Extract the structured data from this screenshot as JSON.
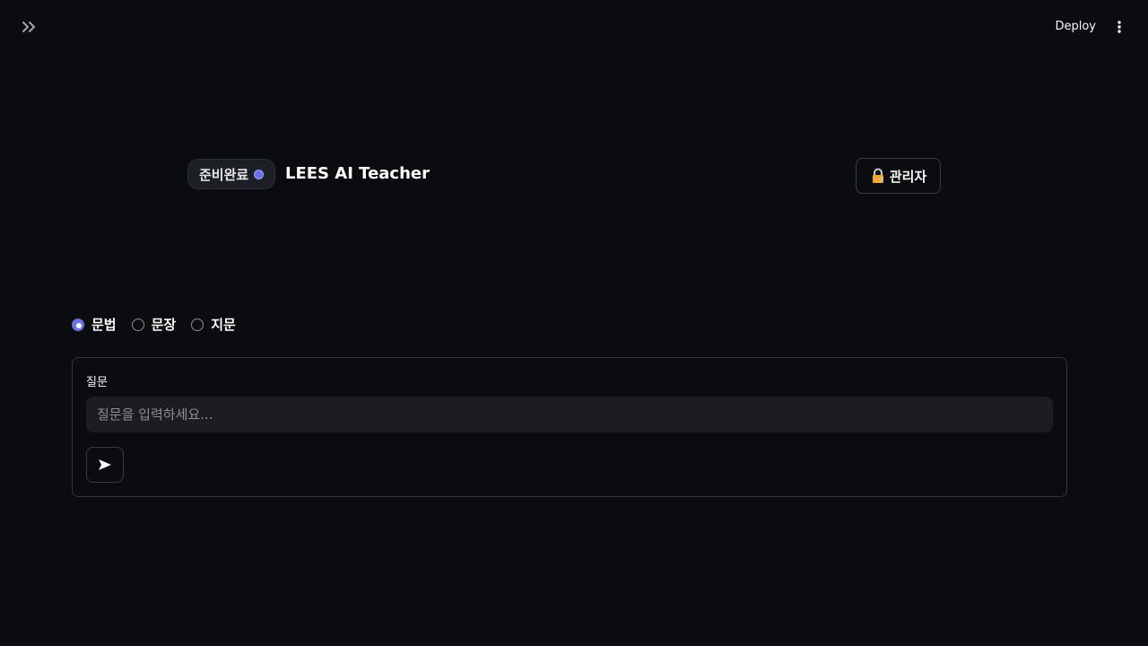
{
  "toolbar": {
    "sidebar_toggle_icon": "double-chevron-right-icon",
    "deploy_label": "Deploy",
    "menu_icon": "vertical-ellipsis-icon"
  },
  "header": {
    "status_label": "준비완료",
    "status_dot_color": "#6b73e0",
    "title": "LEES AI Teacher",
    "admin_icon": "lock-key-icon",
    "admin_label": "관리자"
  },
  "mode": {
    "options": [
      {
        "label": "문법",
        "selected": true
      },
      {
        "label": "문장",
        "selected": false
      },
      {
        "label": "지문",
        "selected": false
      }
    ],
    "accent_color": "#6b73e0"
  },
  "form": {
    "label": "질문",
    "placeholder": "질문을 입력하세요...",
    "value": "",
    "send_icon": "send-arrow-icon"
  }
}
